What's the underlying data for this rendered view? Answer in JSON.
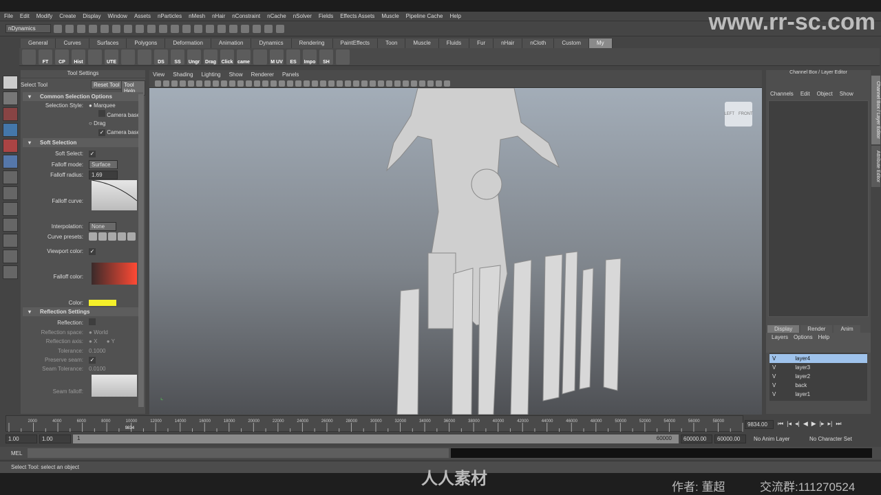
{
  "menu": [
    "File",
    "Edit",
    "Modify",
    "Create",
    "Display",
    "Window",
    "Assets",
    "nParticles",
    "nMesh",
    "nHair",
    "nConstraint",
    "nCache",
    "nSolver",
    "Fields",
    "Effects Assets",
    "Muscle",
    "Pipeline Cache",
    "Help"
  ],
  "status": {
    "menuset": "nDynamics"
  },
  "watermark": {
    "url": "www.rr-sc.com",
    "brand": "人人素材",
    "author": "作者: 董超",
    "group": "交流群:111270524",
    "tile": "人人素材社区"
  },
  "shelf_tabs": [
    "General",
    "Curves",
    "Surfaces",
    "Polygons",
    "Deformation",
    "Animation",
    "Dynamics",
    "Rendering",
    "PaintEffects",
    "Toon",
    "Muscle",
    "Fluids",
    "Fur",
    "nHair",
    "nCloth",
    "Custom",
    "My"
  ],
  "shelf_active": "My",
  "shelf_buttons": [
    "",
    "FT",
    "CP",
    "Hist",
    "",
    "UTE",
    "",
    "",
    "DS",
    "SS",
    "Ungr",
    "Drag",
    "Click",
    "came",
    "",
    "M UV",
    "ES",
    "Impo",
    "SH",
    ""
  ],
  "tool_settings": {
    "title": "Tool Settings",
    "tool": "Select Tool",
    "reset": "Reset Tool",
    "help": "Tool Help",
    "sec1": "Common Selection Options",
    "selection_style": "Selection Style:",
    "marquee": "Marquee",
    "camera_based": "Camera based",
    "drag": "Drag",
    "sec2": "Soft Selection",
    "soft_select": "Soft Select:",
    "falloff_mode": "Falloff mode:",
    "falloff_mode_val": "Surface",
    "falloff_radius": "Falloff radius:",
    "falloff_radius_val": "1.69",
    "falloff_curve": "Falloff curve:",
    "interpolation": "Interpolation:",
    "interpolation_val": "None",
    "curve_presets": "Curve presets:",
    "viewport_color": "Viewport color:",
    "falloff_color": "Falloff color:",
    "color": "Color:",
    "color_hex": "#f5f02a",
    "sec3": "Reflection Settings",
    "reflection": "Reflection:",
    "reflection_space": "Reflection space:",
    "world": "World",
    "reflection_axis": "Reflection axis:",
    "x": "X",
    "y": "Y",
    "tolerance": "Tolerance:",
    "tolerance_val": "0.1000",
    "preserve_seam": "Preserve seam:",
    "seam_tolerance": "Seam Tolerance:",
    "seam_tolerance_val": "0.0100",
    "seam_falloff": "Seam falloff:"
  },
  "viewport": {
    "menu": [
      "View",
      "Shading",
      "Lighting",
      "Show",
      "Renderer",
      "Panels"
    ],
    "cube_left": "LEFT",
    "cube_front": "FRONT"
  },
  "channel_box": {
    "title": "Channel Box / Layer Editor",
    "menu": [
      "Channels",
      "Edit",
      "Object",
      "Show"
    ],
    "tabs": [
      "Display",
      "Render",
      "Anim"
    ],
    "active_tab": "Display",
    "layer_menu": [
      "Layers",
      "Options",
      "Help"
    ],
    "layers": [
      {
        "v": "V",
        "name": "layer4",
        "selected": true
      },
      {
        "v": "V",
        "name": "layer3"
      },
      {
        "v": "V",
        "name": "layer2"
      },
      {
        "v": "V",
        "name": "back"
      },
      {
        "v": "V",
        "name": "layer1"
      }
    ]
  },
  "side_tabs": [
    "Channel Box / Layer Editor",
    "Attribute Editor"
  ],
  "timeline": {
    "ticks": [
      "2000",
      "4000",
      "6000",
      "8000",
      "10000",
      "12000",
      "14000",
      "16000",
      "18000",
      "20000",
      "22000",
      "24000",
      "26000",
      "28000",
      "30000",
      "32000",
      "34000",
      "36000",
      "38000",
      "40000",
      "42000",
      "44000",
      "46000",
      "48000",
      "50000",
      "52000",
      "54000",
      "56000",
      "58000"
    ],
    "current": "9834",
    "current_field": "9834.00",
    "range_min": 0,
    "range_max": 60000
  },
  "range": {
    "start": "1.00",
    "pb_start": "1.00",
    "slider_start": "1",
    "slider_end": "60000",
    "pb_end": "60000.00",
    "end": "60000.00",
    "anim_layer": "No Anim Layer",
    "char_set": "No Character Set"
  },
  "cmd": {
    "label": "MEL"
  },
  "help_line": "Select Tool: select an object"
}
